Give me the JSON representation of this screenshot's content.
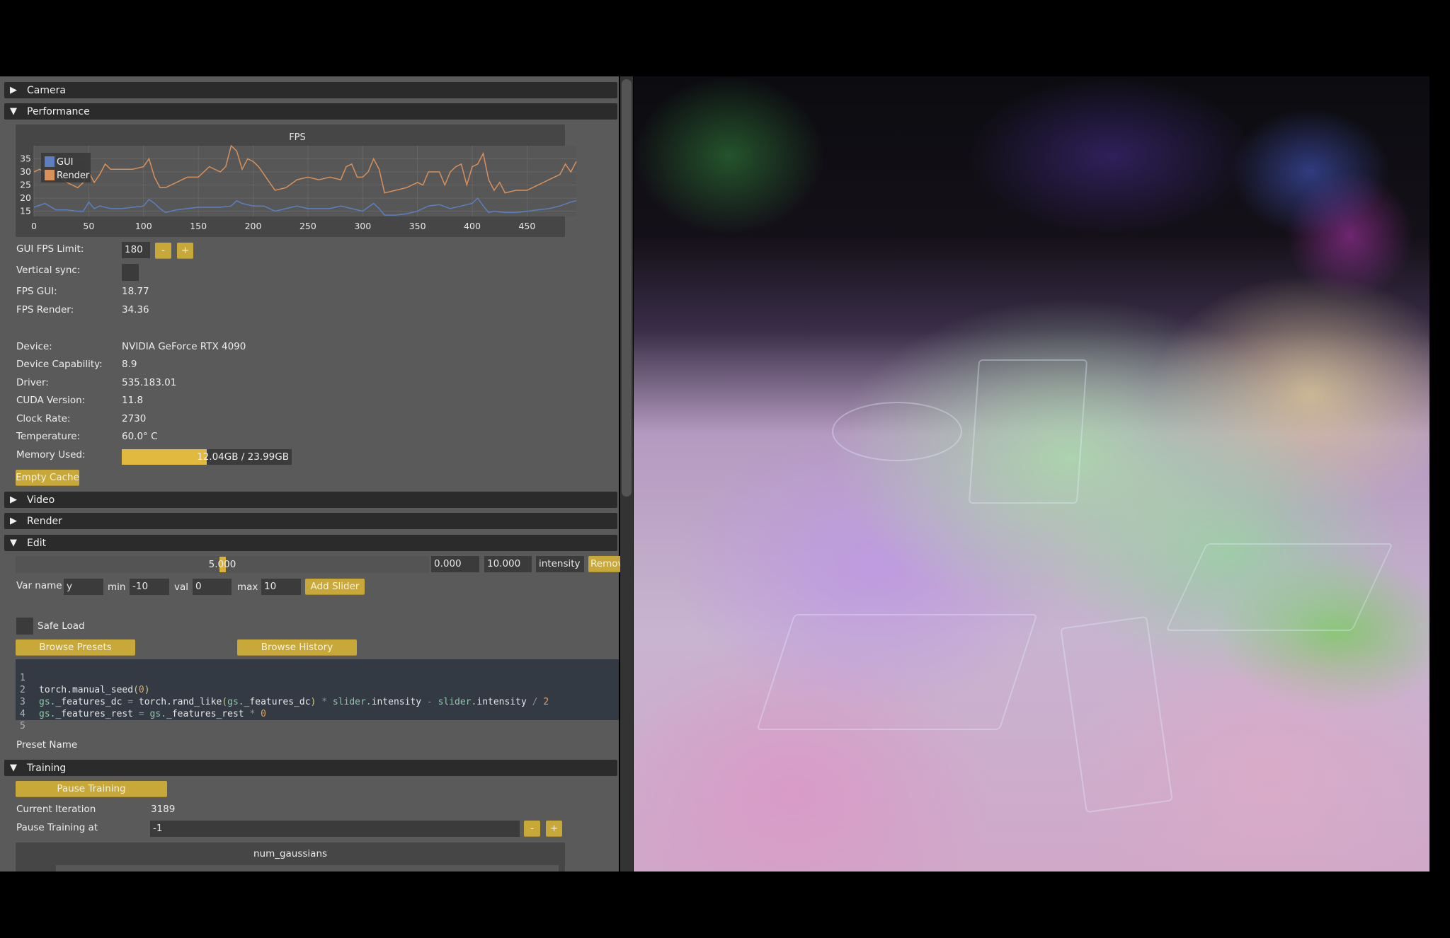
{
  "sections": {
    "camera": {
      "label": "Camera",
      "expanded": false
    },
    "performance": {
      "label": "Performance",
      "expanded": true
    },
    "video": {
      "label": "Video",
      "expanded": false
    },
    "render": {
      "label": "Render",
      "expanded": false
    },
    "edit": {
      "label": "Edit",
      "expanded": true
    },
    "training": {
      "label": "Training",
      "expanded": true
    }
  },
  "icons": {
    "collapsed": "▶",
    "expanded": "▼"
  },
  "performance": {
    "gui_fps_limit_label": "GUI FPS Limit:",
    "gui_fps_limit_value": "180",
    "minus": "-",
    "plus": "+",
    "vsync_label": "Vertical sync:",
    "vsync_checked": false,
    "fps_gui_label": "FPS GUI:",
    "fps_gui_value": "18.77",
    "fps_render_label": "FPS Render:",
    "fps_render_value": "34.36",
    "device_label": "Device:",
    "device_value": "NVIDIA GeForce RTX 4090",
    "capability_label": "Device Capability:",
    "capability_value": "8.9",
    "driver_label": "Driver:",
    "driver_value": "535.183.01",
    "cuda_label": "CUDA Version:",
    "cuda_value": "11.8",
    "clock_label": "Clock Rate:",
    "clock_value": "2730",
    "temp_label": "Temperature:",
    "temp_value": "60.0° C",
    "memory_label": "Memory Used:",
    "memory_text": "12.04GB / 23.99GB",
    "memory_fraction": 0.502,
    "empty_cache_label": "Empty Cache"
  },
  "chart_data": {
    "type": "line",
    "title": "FPS",
    "xlabel": "",
    "ylabel": "",
    "xlim": [
      0,
      495
    ],
    "ylim": [
      13,
      40
    ],
    "xticks": [
      0,
      50,
      100,
      150,
      200,
      250,
      300,
      350,
      400,
      450
    ],
    "yticks": [
      15,
      20,
      25,
      30,
      35
    ],
    "grid": true,
    "legend_position": "top-left",
    "series": [
      {
        "name": "GUI",
        "color": "#5b7fc0",
        "x": [
          0,
          10,
          20,
          30,
          40,
          45,
          50,
          55,
          60,
          70,
          80,
          90,
          100,
          105,
          110,
          115,
          120,
          130,
          140,
          150,
          160,
          170,
          180,
          185,
          190,
          200,
          210,
          220,
          230,
          240,
          250,
          260,
          270,
          280,
          290,
          300,
          310,
          315,
          320,
          330,
          340,
          350,
          360,
          370,
          380,
          390,
          400,
          405,
          410,
          415,
          420,
          430,
          440,
          450,
          460,
          470,
          480,
          490,
          495
        ],
        "values": [
          16.5,
          18,
          15.5,
          15.5,
          15,
          15,
          18.5,
          16,
          17,
          16,
          16,
          16.5,
          17,
          19.5,
          18,
          16,
          14.5,
          15.5,
          16,
          16.5,
          16.5,
          16.5,
          17,
          19,
          18,
          17,
          17,
          15,
          16,
          17,
          16,
          16,
          16,
          17,
          16,
          15,
          18,
          16,
          13.5,
          13.5,
          14,
          15,
          17,
          17.5,
          16,
          17,
          18,
          20,
          17,
          14.5,
          15,
          14.5,
          14.5,
          15,
          15.5,
          16,
          17,
          18.5,
          19
        ]
      },
      {
        "name": "Render",
        "color": "#d9905a",
        "x": [
          0,
          5,
          10,
          20,
          30,
          40,
          45,
          50,
          55,
          60,
          65,
          70,
          80,
          90,
          100,
          105,
          110,
          115,
          120,
          130,
          140,
          150,
          160,
          170,
          175,
          180,
          185,
          190,
          195,
          200,
          205,
          210,
          215,
          220,
          230,
          240,
          250,
          260,
          270,
          280,
          285,
          290,
          295,
          300,
          305,
          310,
          315,
          320,
          330,
          340,
          350,
          355,
          360,
          370,
          375,
          380,
          385,
          390,
          395,
          400,
          405,
          410,
          415,
          420,
          425,
          430,
          440,
          450,
          460,
          470,
          480,
          485,
          490,
          495
        ],
        "values": [
          30,
          31,
          30,
          29,
          26,
          24,
          26,
          30,
          26,
          29,
          33,
          31,
          31,
          31,
          32,
          35,
          28,
          24,
          24,
          26,
          28,
          28,
          32,
          30,
          32,
          40,
          38,
          31,
          35,
          34,
          32,
          29,
          26,
          23,
          24,
          27,
          28,
          27,
          28,
          27,
          32,
          33,
          28,
          28,
          30,
          35,
          31,
          22,
          23,
          24,
          26,
          25,
          30,
          30,
          25,
          30,
          32,
          33,
          25,
          32,
          33,
          37,
          27,
          23,
          26,
          22,
          23,
          23,
          25,
          27,
          29,
          33,
          30,
          34
        ]
      }
    ]
  },
  "edit": {
    "slider_value": "5.000",
    "slider_fraction": 0.5,
    "slider_min": "0.000",
    "slider_max": "10.000",
    "slider_name": "intensity",
    "remove_label": "Remov",
    "var_name_label": "Var name",
    "var_name_value": "y",
    "min_label": "min",
    "min_value": "-10",
    "val_label": "val",
    "val_value": "0",
    "max_label": "max",
    "max_value": "10",
    "add_slider_label": "Add Slider",
    "safe_load_label": "Safe Load",
    "safe_load_checked": false,
    "browse_presets_label": "Browse Presets",
    "browse_history_label": "Browse History",
    "code_lines": [
      {
        "n": "1",
        "text": "torch.manual_seed(0)"
      },
      {
        "n": "2",
        "text": "gs._features_dc = torch.rand_like(gs._features_dc) * slider.intensity - slider.intensity / 2"
      },
      {
        "n": "3",
        "text": "gs._features_rest = gs._features_rest * 0"
      },
      {
        "n": "4",
        "text": ""
      },
      {
        "n": "5",
        "text": ""
      }
    ],
    "preset_name_label": "Preset Name"
  },
  "training": {
    "pause_label": "Pause Training",
    "current_iteration_label": "Current Iteration",
    "current_iteration_value": "3189",
    "pause_at_label": "Pause Training at",
    "pause_at_value": "-1",
    "minus": "-",
    "plus": "+",
    "num_gaussians_title": "num_gaussians"
  },
  "colors": {
    "accent": "#c9a83a",
    "panel_bg": "#5a5a5a",
    "header_bg": "#2b2b2b",
    "input_bg": "#3b3b3b",
    "code_bg": "#343a44"
  }
}
